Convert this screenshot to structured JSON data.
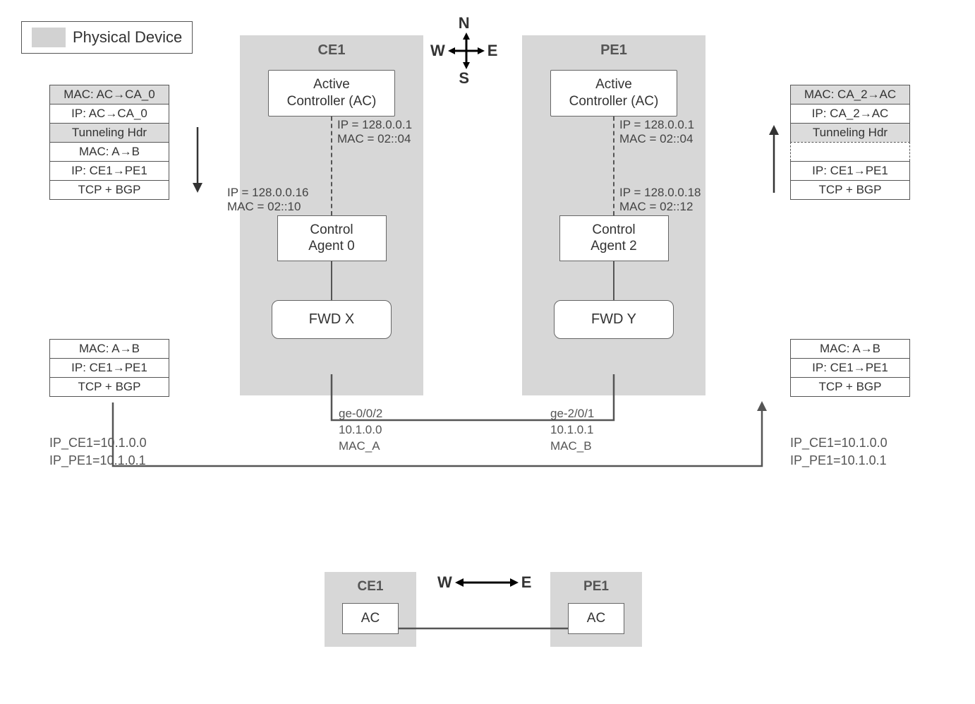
{
  "legend": {
    "label": "Physical Device"
  },
  "compass": {
    "n": "N",
    "s": "S",
    "e": "E",
    "w": "W"
  },
  "devices": {
    "ce1": {
      "title": "CE1",
      "controller": "Active\nController (AC)",
      "ctrl_ip": "IP =  128.0.0.1",
      "ctrl_mac": "MAC = 02::04",
      "agent_ip": "IP =  128.0.0.16",
      "agent_mac": "MAC = 02::10",
      "agent": "Control\nAgent 0",
      "fwd": "FWD X",
      "iface": {
        "name": "ge-0/0/2",
        "ip": "10.1.0.0",
        "mac": "MAC_A"
      }
    },
    "pe1": {
      "title": "PE1",
      "controller": "Active\nController (AC)",
      "ctrl_ip": "IP =  128.0.0.1",
      "ctrl_mac": "MAC = 02::04",
      "agent_ip": "IP =  128.0.0.18",
      "agent_mac": "MAC = 02::12",
      "agent": "Control\nAgent 2",
      "fwd": "FWD Y",
      "iface": {
        "name": "ge-2/0/1",
        "ip": "10.1.0.1",
        "mac": "MAC_B"
      }
    }
  },
  "left_top_stack": [
    "MAC: AC→CA_0",
    "IP: AC→CA_0",
    "Tunneling Hdr",
    "MAC: A→B",
    "IP: CE1→PE1",
    "TCP + BGP"
  ],
  "left_top_shaded": [
    true,
    false,
    true,
    false,
    false,
    false
  ],
  "left_bot_stack": [
    "MAC: A→B",
    "IP: CE1→PE1",
    "TCP + BGP"
  ],
  "right_top_stack": [
    "MAC: CA_2→AC",
    "IP: CA_2→AC",
    "Tunneling Hdr",
    "",
    "IP: CE1→PE1",
    "TCP + BGP"
  ],
  "right_top_shaded": [
    true,
    false,
    true,
    false,
    false,
    false
  ],
  "right_top_dashed": [
    false,
    false,
    false,
    true,
    false,
    false
  ],
  "right_bot_stack": [
    "MAC: A→B",
    "IP: CE1→PE1",
    "TCP + BGP"
  ],
  "ip_note_left": {
    "l1": "IP_CE1=10.1.0.0",
    "l2": "IP_PE1=10.1.0.1"
  },
  "ip_note_right": {
    "l1": "IP_CE1=10.1.0.0",
    "l2": "IP_PE1=10.1.0.1"
  },
  "bottom": {
    "ce1": "CE1",
    "pe1": "PE1",
    "ac": "AC",
    "w": "W",
    "e": "E"
  }
}
